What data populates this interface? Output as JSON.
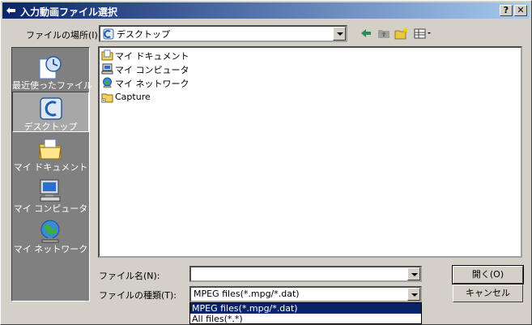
{
  "window": {
    "title": "入力動画ファイル選択"
  },
  "titlebar_buttons": {
    "help": "?",
    "close": "✕"
  },
  "look_in": {
    "label": "ファイルの場所(I):",
    "value": "デスクトップ"
  },
  "places": [
    {
      "name": "recent",
      "label": "最近使ったファイル"
    },
    {
      "name": "desktop",
      "label": "デスクトップ"
    },
    {
      "name": "mydocs",
      "label": "マイ ドキュメント"
    },
    {
      "name": "mycomputer",
      "label": "マイ コンピュータ"
    },
    {
      "name": "network",
      "label": "マイ ネットワーク"
    }
  ],
  "files": [
    {
      "label": "マイ ドキュメント",
      "icon": "documents-icon"
    },
    {
      "label": "マイ コンピュータ",
      "icon": "computer-icon"
    },
    {
      "label": "マイ ネットワーク",
      "icon": "network-icon"
    },
    {
      "label": "Capture",
      "icon": "folder-icon"
    }
  ],
  "filename": {
    "label": "ファイル名(N):",
    "value": ""
  },
  "filetype": {
    "label": "ファイルの種類(T):",
    "value": "MPEG files(*.mpg/*.dat)",
    "options": [
      "MPEG files(*.mpg/*.dat)",
      "All files(*.*)"
    ]
  },
  "buttons": {
    "open": "開く(O)",
    "cancel": "キャンセル"
  }
}
